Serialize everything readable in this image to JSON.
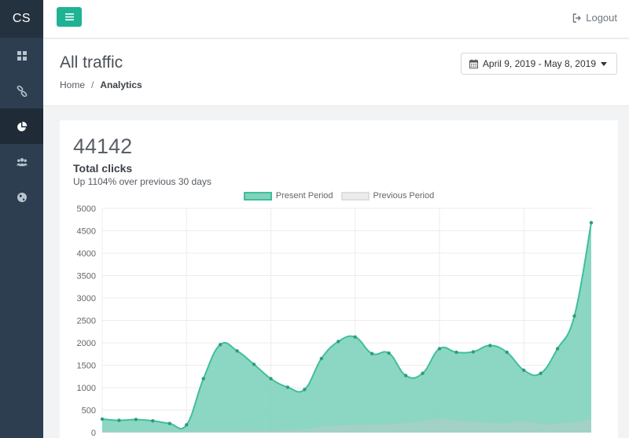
{
  "brand": "CS",
  "sidebar": {
    "items": [
      {
        "name": "dashboard",
        "icon": "grid-icon",
        "active": false
      },
      {
        "name": "links",
        "icon": "link-icon",
        "active": false
      },
      {
        "name": "analytics",
        "icon": "pie-chart-icon",
        "active": true
      },
      {
        "name": "users",
        "icon": "users-icon",
        "active": false
      },
      {
        "name": "globe",
        "icon": "globe-icon",
        "active": false
      }
    ]
  },
  "topbar": {
    "logout_label": "Logout"
  },
  "header": {
    "title": "All traffic",
    "breadcrumb": {
      "home": "Home",
      "sep": "/",
      "current": "Analytics"
    },
    "date_range": "April 9, 2019 - May 8, 2019"
  },
  "stats": {
    "value": "44142",
    "label": "Total clicks",
    "subtitle": "Up 1104% over previous 30 days"
  },
  "colors": {
    "accent": "#1fb394",
    "present_line": "#3fbf9b",
    "present_fill": "#7fd3bd",
    "previous_fill": "#e8e8e8",
    "sidebar": "#2c3e50"
  },
  "chart_data": {
    "type": "area",
    "legend": [
      "Present Period",
      "Previous Period"
    ],
    "y_ticks": [
      "5000",
      "4500",
      "4000",
      "3500",
      "3000",
      "2500",
      "2000",
      "1500",
      "1000",
      "500",
      "0"
    ],
    "ylim": [
      0,
      5000
    ],
    "grid": true,
    "series": [
      {
        "name": "Present Period",
        "values": [
          300,
          270,
          290,
          260,
          200,
          170,
          1200,
          1960,
          1820,
          1520,
          1200,
          1010,
          960,
          1650,
          2030,
          2130,
          1760,
          1770,
          1270,
          1320,
          1870,
          1790,
          1800,
          1940,
          1790,
          1390,
          1320,
          1870,
          2600,
          4680
        ]
      },
      {
        "name": "Previous Period",
        "values": [
          20,
          15,
          18,
          15,
          12,
          10,
          15,
          20,
          25,
          30,
          35,
          45,
          60,
          130,
          150,
          160,
          170,
          190,
          200,
          250,
          300,
          260,
          230,
          210,
          200,
          250,
          190,
          200,
          220,
          300
        ]
      }
    ]
  }
}
